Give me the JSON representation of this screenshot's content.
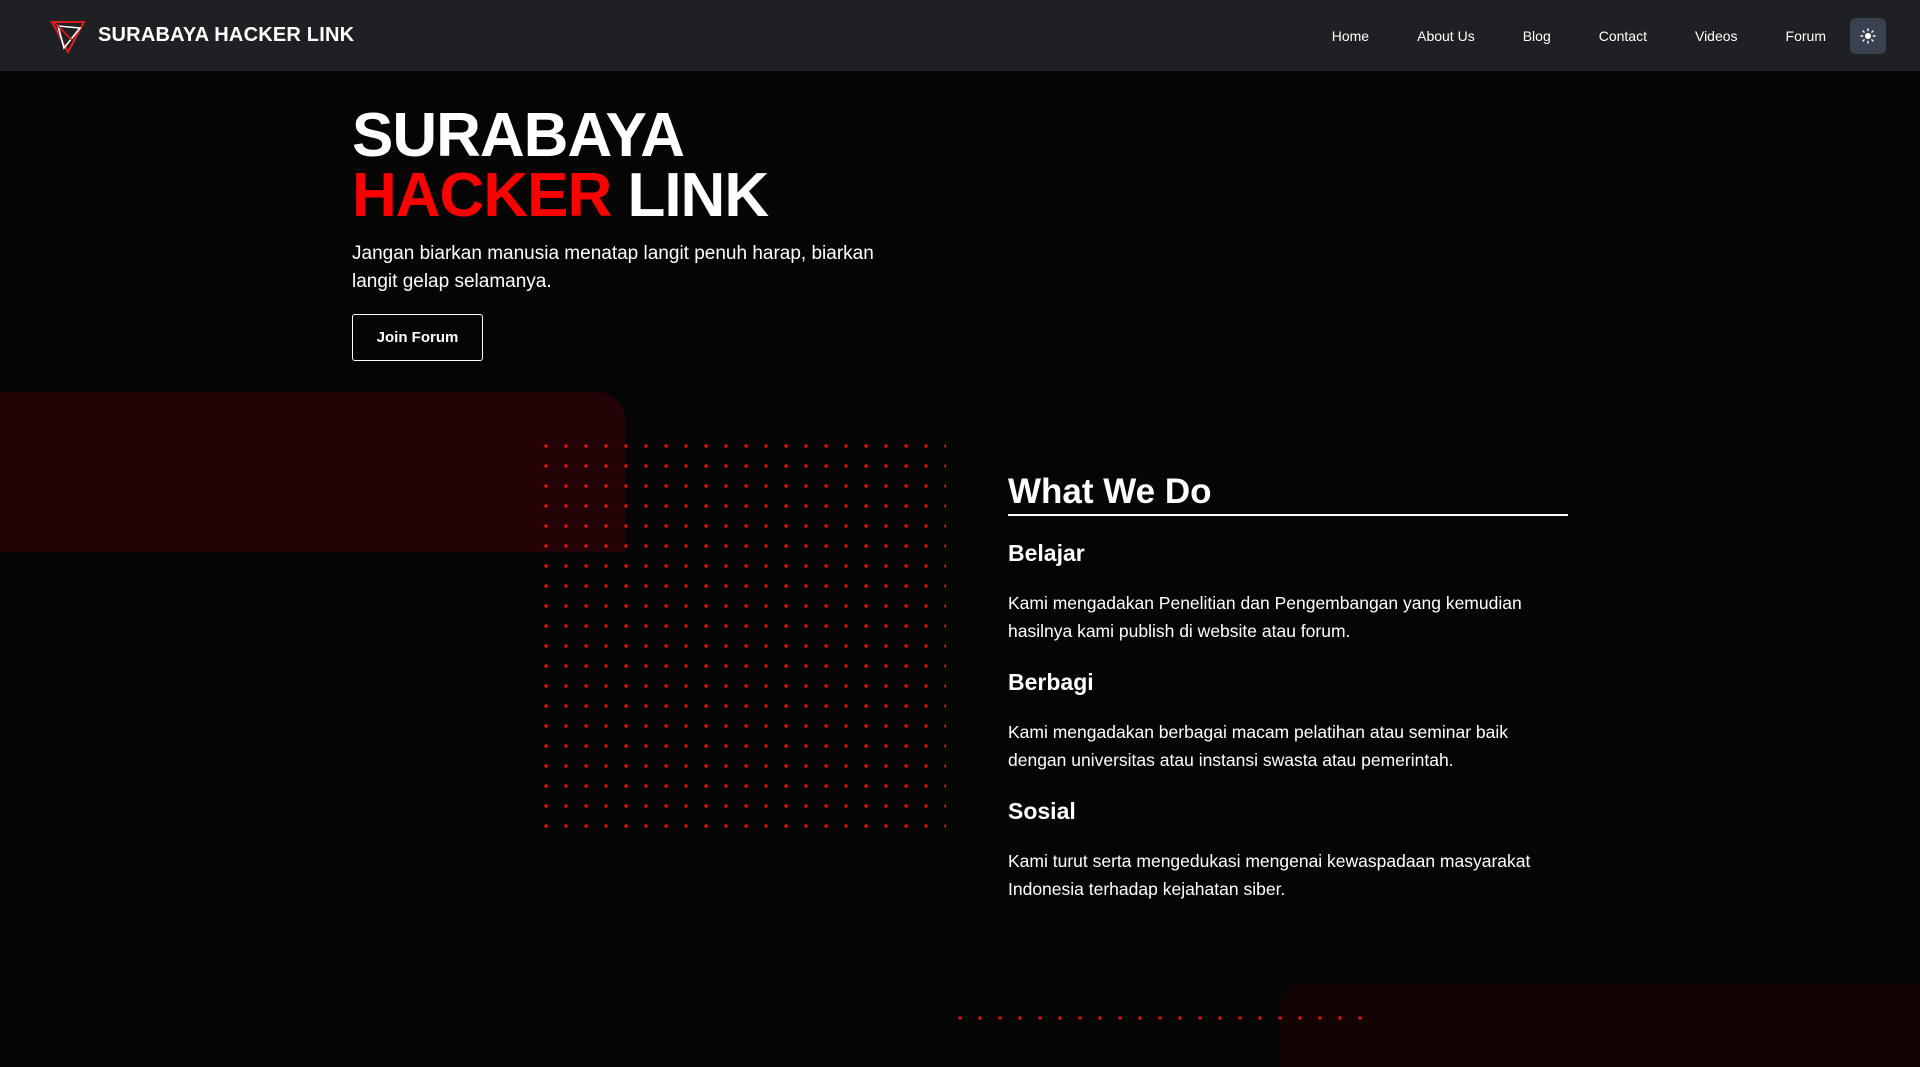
{
  "brand": {
    "name": "SURABAYA HACKER LINK"
  },
  "nav": {
    "links": [
      "Home",
      "About Us",
      "Blog",
      "Contact",
      "Videos",
      "Forum"
    ],
    "theme_toggle_icon": "sun-icon"
  },
  "hero": {
    "title_line1": "SURABAYA",
    "title_red": "HACKER",
    "title_white": " LINK",
    "tagline": "Jangan biarkan manusia menatap langit penuh harap, biarkan langit gelap selamanya.",
    "cta_label": "Join Forum"
  },
  "what_we_do": {
    "heading": "What We Do",
    "items": [
      {
        "title": "Belajar",
        "description": "Kami mengadakan Penelitian dan Pengembangan yang kemudian hasilnya kami publish di website atau forum."
      },
      {
        "title": "Berbagi",
        "description": "Kami mengadakan berbagai macam pelatihan atau seminar baik dengan universitas atau instansi swasta atau pemerintah."
      },
      {
        "title": "Sosial",
        "description": "Kami turut serta mengedukasi mengenai kewaspadaan masyarakat Indonesia terhadap kejahatan siber."
      }
    ]
  },
  "colors": {
    "accent": "#ff0000",
    "navbar_bg": "#1f2023",
    "page_bg": "#050505",
    "toggle_bg": "#3a4150"
  }
}
